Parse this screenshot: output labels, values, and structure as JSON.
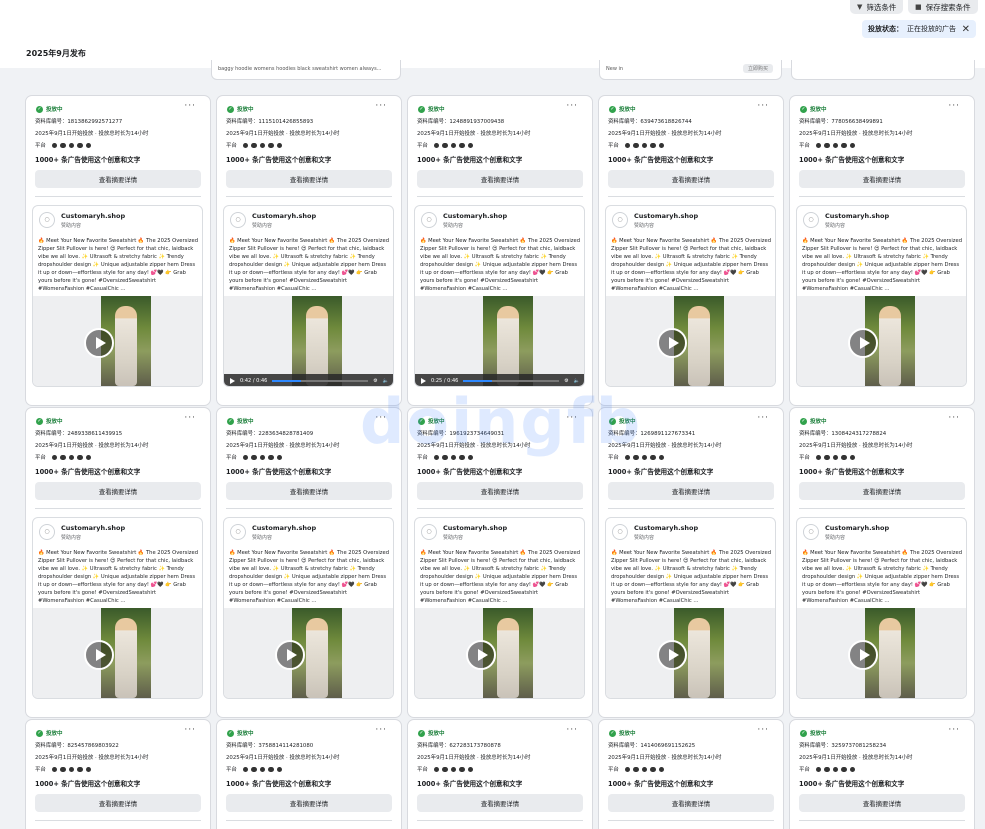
{
  "toolbar": {
    "filter_label": "筛选条件",
    "save_label": "保存搜索条件"
  },
  "status_filter": {
    "label": "投放状态：",
    "value": "正在投放的广告"
  },
  "date_heading": "2025年9月发布",
  "peek": {
    "card1_text": "baggy hoodie womens hoodies black sweatshirt women always...",
    "card4_text": "New in",
    "card4_button": "立即购买"
  },
  "watermark": "doingfb",
  "card_common": {
    "status": "投放中",
    "launch_text": "2025年9月1日开始投放 · 投放总时长为14小时",
    "platform_label": "平台",
    "count_text": "1000+ 条广告使用这个创意和文字",
    "detail_button": "查看摘要详情",
    "page_name": "Customaryh.shop",
    "sponsored": "赞助内容",
    "ad_body": "🔥 Meet Your New Favorite Sweatshirt 🔥 The 2025 Oversized Zipper Slit Pullover is here! 😍 Perfect for that chic, laidback vibe we all love. ✨ Ultrasoft & stretchy fabric ✨ Trendy dropshoulder design ✨ Unique adjustable zipper hem Dress it up or down—effortless style for any day! 💕🖤 👉 Grab yours before it's gone! #OversizedSweatshirt #WomensFashion #CasualChic ..."
  },
  "cards": [
    {
      "id_label": "资料库编号：1813862992571277",
      "time": ""
    },
    {
      "id_label": "资料库编号：1115101426855893",
      "time": "0:42 / 0:46"
    },
    {
      "id_label": "资料库编号：1248891937009438",
      "time": "0:25 / 0:46"
    },
    {
      "id_label": "资料库编号：639473618826744",
      "time": ""
    },
    {
      "id_label": "资料库编号：778056638499891",
      "time": ""
    },
    {
      "id_label": "资料库编号：2489338611439915",
      "time": ""
    },
    {
      "id_label": "资料库编号：2283634828781409",
      "time": ""
    },
    {
      "id_label": "资料库编号：1961923734649031",
      "time": ""
    },
    {
      "id_label": "资料库编号：1269891127673341",
      "time": ""
    },
    {
      "id_label": "资料库编号：1308424317278824",
      "time": ""
    },
    {
      "id_label": "资料库编号：825457869803922",
      "time": ""
    },
    {
      "id_label": "资料库编号：3758814114281080",
      "time": ""
    },
    {
      "id_label": "资料库编号：627283173780878",
      "time": ""
    },
    {
      "id_label": "资料库编号：1414069691152625",
      "time": ""
    },
    {
      "id_label": "资料库编号：3259737081258234",
      "time": ""
    }
  ]
}
